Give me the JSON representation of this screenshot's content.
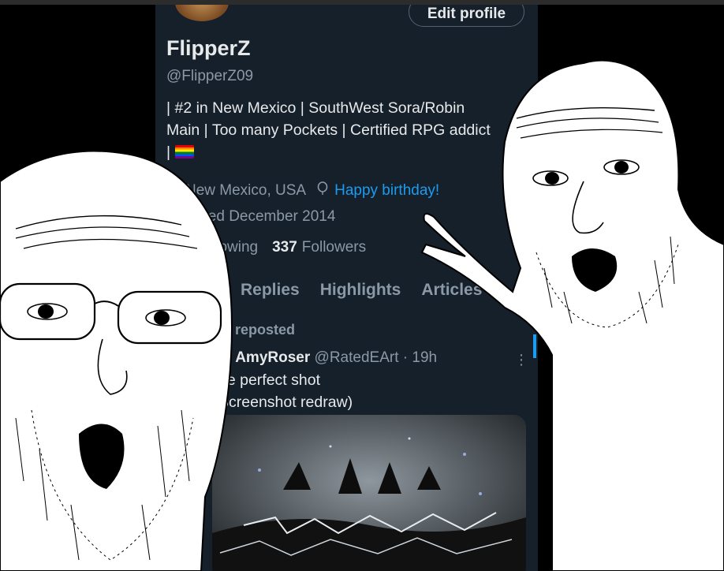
{
  "profile": {
    "edit_label": "Edit profile",
    "display_name": "FlipperZ",
    "handle": "@FlipperZ09",
    "bio": "| #2 in New Mexico | SouthWest Sora/Robin Main | Too many Pockets | Certified RPG addict |",
    "bio_emoji": "rainbow-flag",
    "location": "New Mexico, USA",
    "birthday": "Happy birthday!",
    "joined": "ined December 2014",
    "following_label": "llowing",
    "followers_count": "337",
    "followers_label": "Followers"
  },
  "tabs": [
    "Replies",
    "Highlights",
    "Articles"
  ],
  "timeline": {
    "repost_label": "u reposted",
    "author_name": "AmyRoser",
    "author_handle": "@RatedEArt",
    "time": "· 19h",
    "text_line1": "he perfect shot",
    "text_line2": "Screenshot redraw)",
    "more_icon": "more-vertical-icon"
  },
  "colors": {
    "panel_bg": "#15202b",
    "accent": "#1d9bf0",
    "muted": "#8b98a5",
    "text": "#e7e9ea"
  }
}
